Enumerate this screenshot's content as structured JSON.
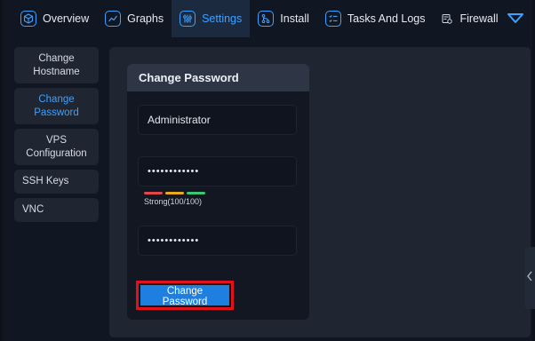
{
  "nav": {
    "items": [
      {
        "label": "Overview",
        "icon": "cube-icon"
      },
      {
        "label": "Graphs",
        "icon": "chart-line-icon"
      },
      {
        "label": "Settings",
        "icon": "sliders-icon"
      },
      {
        "label": "Install",
        "icon": "git-branch-icon"
      },
      {
        "label": "Tasks And Logs",
        "icon": "checklist-icon"
      },
      {
        "label": "Firewall",
        "icon": "firewall-icon"
      }
    ],
    "active": "Settings"
  },
  "sidebar": {
    "items": [
      {
        "label": "Change Hostname"
      },
      {
        "label": "Change Password"
      },
      {
        "label": "VPS Configuration"
      },
      {
        "label": "SSH Keys"
      },
      {
        "label": "VNC"
      }
    ],
    "active": "Change Password"
  },
  "card": {
    "title": "Change Password",
    "username": "Administrator",
    "password": "••••••••••••",
    "confirm_password": "••••••••••••",
    "strength_label": "Strong(100/100)",
    "strength_colors": [
      "#e0464a",
      "#e8a91c",
      "#3cc772"
    ],
    "submit_label": "Change Password"
  },
  "colors": {
    "accent": "#3ea0ff",
    "highlight_border": "#e0121b"
  }
}
